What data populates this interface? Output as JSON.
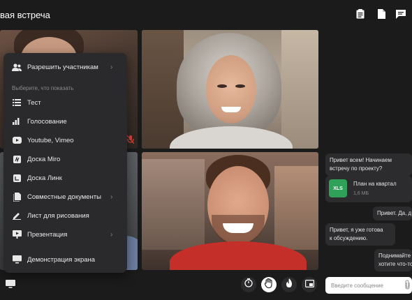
{
  "header": {
    "title": "вая встреча",
    "icons": [
      "clipboard-icon",
      "document-icon",
      "chat-icon"
    ]
  },
  "menu": {
    "allow_label": "Разрешить участникам",
    "hint": "Выберите, что показать",
    "items": [
      {
        "label": "Тест",
        "icon": "list-icon",
        "has_submenu": false
      },
      {
        "label": "Голосование",
        "icon": "bar-chart-icon",
        "has_submenu": false
      },
      {
        "label": "Youtube, Vimeo",
        "icon": "youtube-icon",
        "has_submenu": false
      },
      {
        "label": "Доска Miro",
        "icon": "miro-icon",
        "has_submenu": false
      },
      {
        "label": "Доска Линк",
        "icon": "link-board-icon",
        "has_submenu": false
      },
      {
        "label": "Совместные документы",
        "icon": "docs-icon",
        "has_submenu": true
      },
      {
        "label": "Лист для рисования",
        "icon": "pen-icon",
        "has_submenu": false
      },
      {
        "label": "Презентация",
        "icon": "presentation-icon",
        "has_submenu": true
      },
      {
        "label": "Демонстрация экрана",
        "icon": "screen-icon",
        "has_submenu": false
      }
    ]
  },
  "chat": {
    "messages": [
      {
        "text_line1": "Привет всем! Начинаем",
        "text_line2": "встречу по проекту?"
      },
      {
        "text_line1": "Привет. Да, д",
        "text_line2": ""
      },
      {
        "text_line1": "Привет, я уже готова",
        "text_line2": "к обсуждению."
      },
      {
        "text_line1": "Поднимайте р",
        "text_line2": "хотите что-то"
      }
    ],
    "file": {
      "badge": "XLS",
      "name": "План на квартал",
      "size": "1,6 МБ"
    },
    "input_placeholder": "Введите сообщение"
  },
  "controls": [
    "timer-icon",
    "raise-hand-icon",
    "flame-icon",
    "pip-icon"
  ],
  "colors": {
    "background": "#1b1b1c",
    "panel": "#2a2a2c",
    "bubble": "#2c2c2e",
    "xls_green": "#2fa158",
    "mic_off_red": "#e0453a"
  }
}
